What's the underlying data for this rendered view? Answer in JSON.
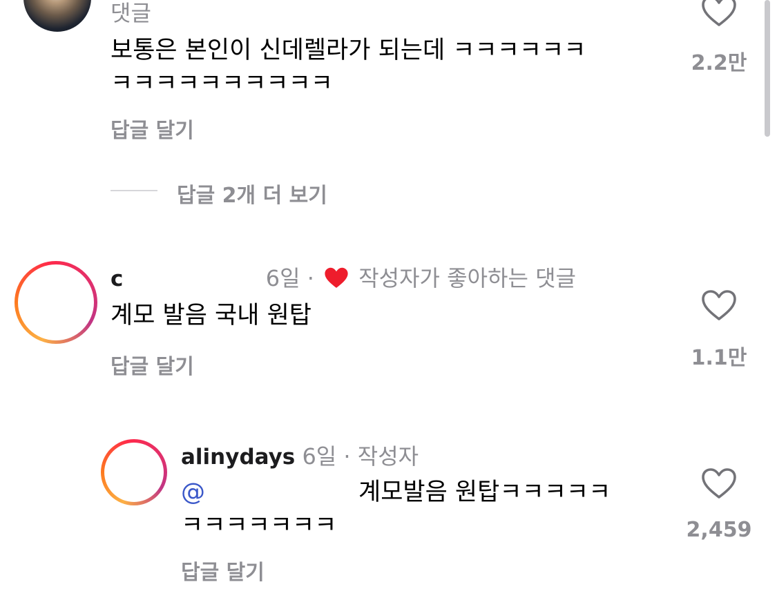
{
  "comments": [
    {
      "meta": "댓글",
      "text_line1": "보통은 본인이 신데렐라가 되는데 ㅋㅋㅋㅋㅋㅋ",
      "text_line2": "ㅋㅋㅋㅋㅋㅋㅋㅋㅋㅋ",
      "reply_label": "답글 달기",
      "like_count": "2.2만",
      "view_replies": "답글 2개 더 보기"
    },
    {
      "username_partial": "c",
      "time": "6일",
      "separator": "·",
      "author_liked": "작성자가 좋아하는 댓글",
      "text": "계모 발음 국내 원탑",
      "reply_label": "답글 달기",
      "like_count": "1.1만"
    },
    {
      "username": "alinydays",
      "time": "6일",
      "separator": "·",
      "author_badge": "작성자",
      "mention_partial": "@",
      "text_line1": "계모발음 원탑ㅋㅋㅋㅋㅋ",
      "text_line2": "ㅋㅋㅋㅋㅋㅋㅋ",
      "reply_label": "답글 달기",
      "like_count": "2,459"
    }
  ],
  "icons": {
    "like": "heart-outline-icon",
    "author_liked": "heart-filled-icon"
  },
  "colors": {
    "muted": "#8e8e93",
    "liked_heart": "#ee1d2c",
    "mention": "#3b58c9"
  }
}
